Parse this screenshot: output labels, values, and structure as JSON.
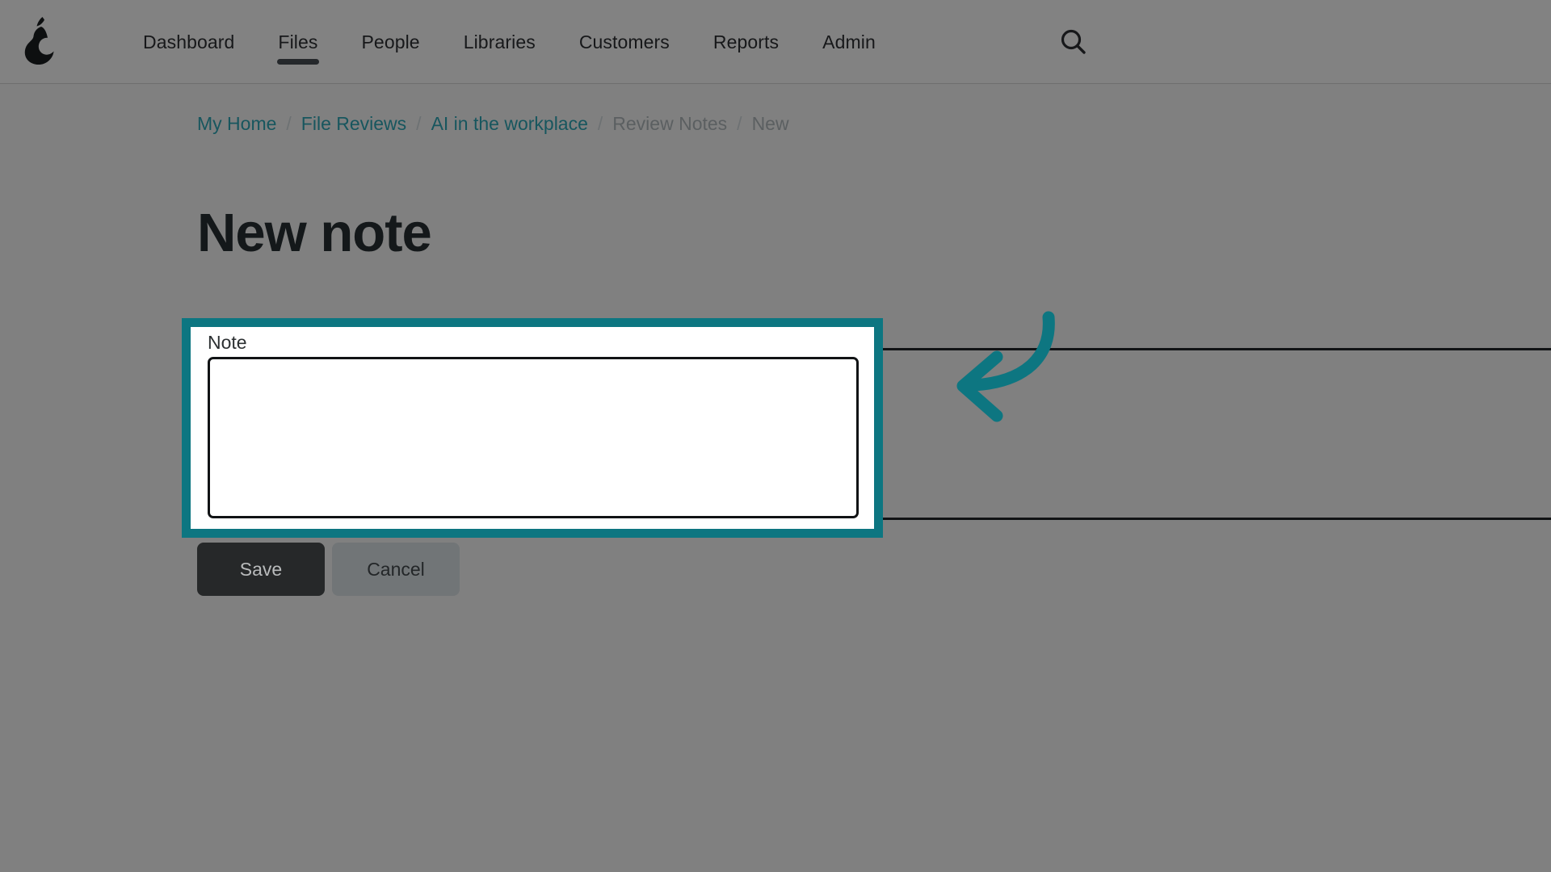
{
  "colors": {
    "page_background": "#808080",
    "nav_background": "#828282",
    "accent_teal": "#0d7681",
    "link_teal": "#17565e",
    "text_dark": "#14181a",
    "muted_text": "#5b5f61",
    "save_button_bg": "#262829",
    "cancel_button_bg": "#717577"
  },
  "navbar": {
    "logo_name": "pear-logo",
    "items": [
      {
        "label": "Dashboard",
        "active": false
      },
      {
        "label": "Files",
        "active": true
      },
      {
        "label": "People",
        "active": false
      },
      {
        "label": "Libraries",
        "active": false
      },
      {
        "label": "Customers",
        "active": false
      },
      {
        "label": "Reports",
        "active": false
      },
      {
        "label": "Admin",
        "active": false
      }
    ],
    "search_icon": "search-icon"
  },
  "breadcrumb": {
    "separator": "/",
    "items": [
      {
        "label": "My Home",
        "type": "link"
      },
      {
        "label": "File Reviews",
        "type": "link"
      },
      {
        "label": "AI in the workplace",
        "type": "link"
      },
      {
        "label": "Review Notes",
        "type": "plain"
      },
      {
        "label": "New",
        "type": "plain"
      }
    ]
  },
  "page": {
    "title": "New note"
  },
  "form": {
    "note_field": {
      "label": "Note",
      "value": "",
      "placeholder": ""
    },
    "buttons": {
      "save_label": "Save",
      "cancel_label": "Cancel"
    }
  },
  "annotation": {
    "arrow_name": "curved-left-arrow",
    "arrow_color": "#0d7681",
    "points_to": "Note"
  }
}
